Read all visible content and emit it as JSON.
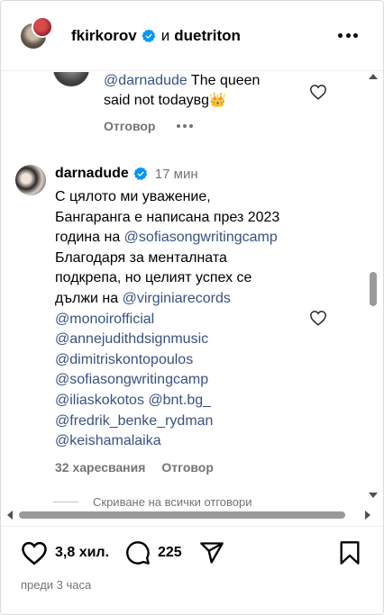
{
  "header": {
    "user1": "fkirkorov",
    "conjunction": "и",
    "user2": "duetriton"
  },
  "reply": {
    "mention": "@darnadude",
    "text_line1_rest": " The queen",
    "text_line2": "said not todayвg",
    "crown": "👑",
    "reply_label": "Отговор"
  },
  "comment": {
    "username": "darnadude",
    "time": "17 мин",
    "lines": [
      {
        "text": "С цялото ми уважение,"
      },
      {
        "text": "Бангаранга е написана през 2023"
      },
      {
        "text": "година на ",
        "mention": "@sofiasongwritingcamp"
      },
      {
        "text": "Благодаря за менталната"
      },
      {
        "text": "подкрепа, но целият успех се"
      },
      {
        "text": "дължи на ",
        "mention": "@virginiarecords"
      },
      {
        "mention": "@monoirofficial"
      },
      {
        "mention": "@annejudithdsignmusic"
      },
      {
        "mention": "@dimitriskontopoulos"
      },
      {
        "mention": "@sofiasongwritingcamp"
      },
      {
        "mention": "@iliaskokotos @bnt.bg_"
      },
      {
        "mention": "@fredrik_benke_rydman"
      },
      {
        "mention": "@keishamalaika"
      }
    ],
    "likes": "32 харесвания",
    "reply_label": "Отговор"
  },
  "hide_replies": "Скриване на всички отговори",
  "actions": {
    "likes_count": "3,8 хил.",
    "comments_count": "225",
    "timestamp": "преди 3 часа"
  },
  "colors": {
    "mention": "#385185",
    "verified": "#0095f6",
    "muted": "#737373"
  }
}
